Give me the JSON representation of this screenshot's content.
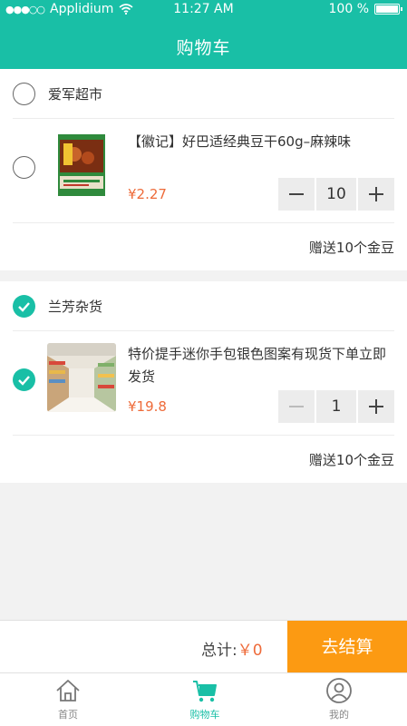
{
  "status_bar": {
    "carrier": "Applidium",
    "time": "11:27 AM",
    "battery": "100 %"
  },
  "nav": {
    "title": "购物车"
  },
  "stores": [
    {
      "name": "爱军超市",
      "checked": false,
      "item": {
        "title": "【徽记】好巴适经典豆干60g–麻辣味",
        "price": "¥2.27",
        "quantity": "10",
        "checked": false
      },
      "bonus": "赠送10个金豆"
    },
    {
      "name": "兰芳杂货",
      "checked": true,
      "item": {
        "title": "特价提手迷你手包银色图案有现货下单立即发货",
        "price": "¥19.8",
        "quantity": "1",
        "checked": true
      },
      "bonus": "赠送10个金豆"
    }
  ],
  "total": {
    "label": "总计:",
    "value": "￥0",
    "checkout_label": "去结算"
  },
  "tabs": [
    {
      "label": "首页",
      "icon": "home-icon"
    },
    {
      "label": "购物车",
      "icon": "cart-icon"
    },
    {
      "label": "我的",
      "icon": "user-icon"
    }
  ],
  "colors": {
    "primary": "#19bfa6",
    "price": "#ee6b3a",
    "checkout": "#fc9a12"
  }
}
